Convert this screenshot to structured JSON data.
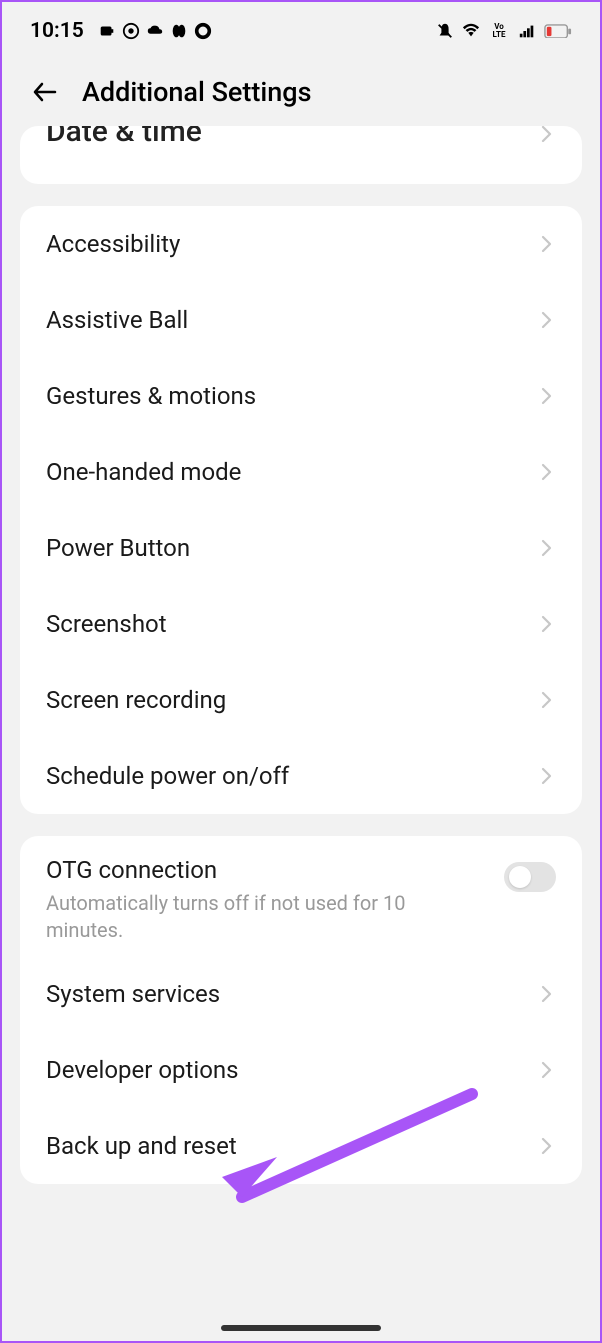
{
  "status": {
    "time": "10:15",
    "icons_left": [
      "charge-icon",
      "circle-dot-icon",
      "cloud-icon",
      "pill-icon",
      "ring-icon"
    ],
    "icons_right": [
      "mute-icon",
      "wifi-icon",
      "volte-icon",
      "signal-icon",
      "battery-low-icon"
    ]
  },
  "header": {
    "title": "Additional Settings"
  },
  "partial_row": {
    "label": "Date & time"
  },
  "group1": [
    {
      "label": "Accessibility"
    },
    {
      "label": "Assistive Ball"
    },
    {
      "label": "Gestures & motions"
    },
    {
      "label": "One-handed mode"
    },
    {
      "label": "Power Button"
    },
    {
      "label": "Screenshot"
    },
    {
      "label": "Screen recording"
    },
    {
      "label": "Schedule power on/off"
    }
  ],
  "group2": {
    "otg": {
      "label": "OTG connection",
      "sublabel": "Automatically turns off if not used for 10 minutes.",
      "enabled": false
    },
    "items": [
      {
        "label": "System services"
      },
      {
        "label": "Developer options"
      },
      {
        "label": "Back up and reset"
      }
    ]
  }
}
